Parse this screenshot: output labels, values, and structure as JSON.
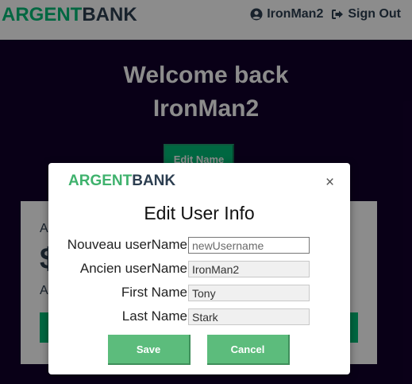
{
  "header": {
    "logo_part1": "ARGENT",
    "logo_part2": "BANK",
    "username": "IronMan2",
    "signout_label": "Sign Out"
  },
  "main": {
    "welcome_line1": "Welcome back",
    "welcome_line2": "IronMan2",
    "edit_name_label": "Edit Name",
    "account_title": "A",
    "account_amount": "$",
    "account_desc": "A"
  },
  "modal": {
    "logo_part1": "ARGENT",
    "logo_part2": "BANK",
    "close_glyph": "×",
    "title": "Edit User Info",
    "fields": [
      {
        "label": "Nouveau userName",
        "value": "",
        "placeholder": "newUsername"
      },
      {
        "label": "Ancien userName",
        "value": "IronMan2"
      },
      {
        "label": "First Name",
        "value": "Tony"
      },
      {
        "label": "Last Name",
        "value": "Stark"
      }
    ],
    "save_label": "Save",
    "cancel_label": "Cancel"
  },
  "colors": {
    "brand_green": "#00bc77",
    "dark_text": "#2c3e50",
    "page_bg": "#12002b",
    "button_green": "#5cbc7c"
  },
  "icons": {
    "user": "user-circle-icon",
    "signout": "sign-out-icon",
    "close": "close-icon"
  }
}
